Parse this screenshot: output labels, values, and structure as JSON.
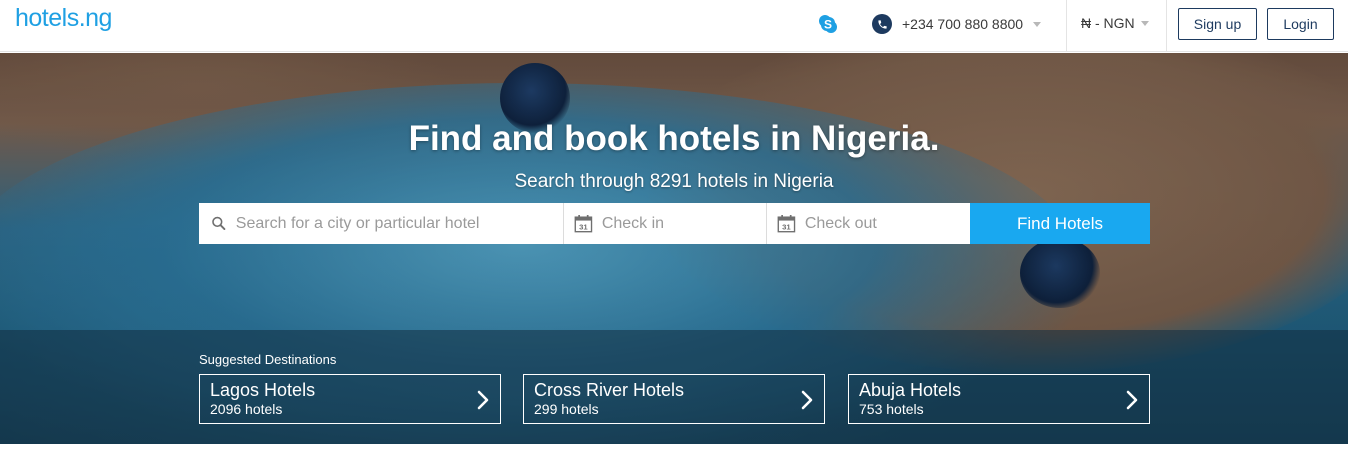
{
  "header": {
    "logo": "hotels.ng",
    "phone": "+234 700 880 8800",
    "currency": "₦ - NGN",
    "signup_label": "Sign up",
    "login_label": "Login"
  },
  "hero": {
    "title": "Find and book hotels in Nigeria.",
    "subtitle": "Search through 8291 hotels in Nigeria"
  },
  "search": {
    "city_placeholder": "Search for a city or particular hotel",
    "checkin_placeholder": "Check in",
    "checkout_placeholder": "Check out",
    "calendar_day": "31",
    "button_label": "Find Hotels"
  },
  "suggested": {
    "label": "Suggested Destinations",
    "items": [
      {
        "name": "Lagos Hotels",
        "count": "2096 hotels"
      },
      {
        "name": "Cross River Hotels",
        "count": "299 hotels"
      },
      {
        "name": "Abuja Hotels",
        "count": "753 hotels"
      }
    ]
  },
  "colors": {
    "brand_blue": "#1fa0e3",
    "navy": "#1d3a5f",
    "find_button": "#19a8f0"
  },
  "icons": [
    "skype-icon",
    "phone-icon",
    "search-icon",
    "calendar-icon",
    "chevron-right-icon",
    "caret-down-icon"
  ]
}
